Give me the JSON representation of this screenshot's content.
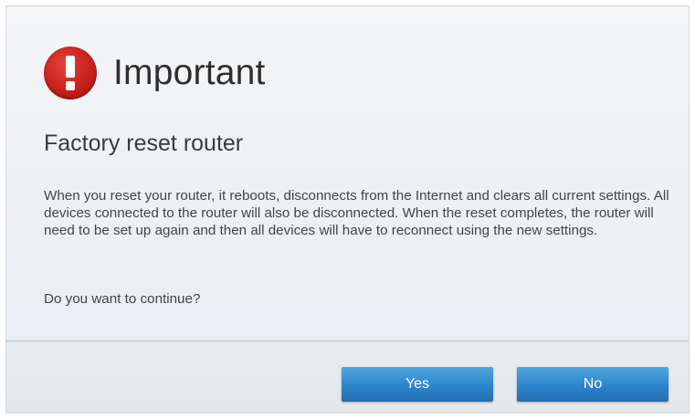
{
  "dialog": {
    "icon": "exclamation-icon",
    "title": "Important",
    "subtitle": "Factory reset router",
    "body": "When you reset your router, it reboots, disconnects from the Internet and clears all current settings. All devices connected to the router will also be disconnected. When the reset completes, the router will need to be set up again and then all devices will have to reconnect using the new settings.",
    "question": "Do you want to continue?"
  },
  "buttons": {
    "yes_label": "Yes",
    "no_label": "No"
  },
  "colors": {
    "alert_red": "#c8201a",
    "button_blue": "#2d85cb"
  }
}
